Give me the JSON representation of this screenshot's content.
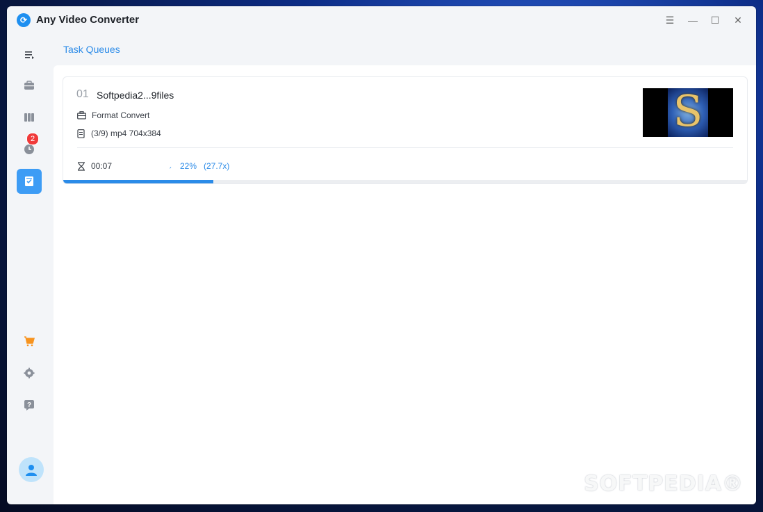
{
  "app": {
    "title": "Any Video Converter",
    "logo_icon": "app-logo-icon"
  },
  "window_controls": [
    "menu-icon",
    "minimize-icon",
    "maximize-icon",
    "close-icon"
  ],
  "sidebar": {
    "items": [
      {
        "name": "menu-toggle",
        "icon": "list-icon"
      },
      {
        "name": "toolbox",
        "icon": "briefcase-icon"
      },
      {
        "name": "library",
        "icon": "columns-icon"
      },
      {
        "name": "history",
        "icon": "clock-icon",
        "badge": "2"
      },
      {
        "name": "task-queues",
        "icon": "checklist-icon",
        "active": true
      },
      {
        "name": "store",
        "icon": "cart-icon"
      },
      {
        "name": "settings",
        "icon": "gear-icon"
      },
      {
        "name": "help",
        "icon": "question-icon"
      }
    ]
  },
  "page": {
    "title": "Task Queues"
  },
  "task": {
    "index": "01",
    "name": "Softpedia2...9files",
    "type": "Format Convert",
    "details": "(3/9) mp4 704x384",
    "elapsed": "00:07",
    "spinner": "ˏ",
    "percent": "22%",
    "speed": "(27.7x)",
    "progress": 0.22,
    "thumbnail_letter": "S"
  },
  "watermark": "SOFTPEDIA®",
  "colors": {
    "accent": "#2b8be8",
    "badge": "#f03a3a",
    "store": "#f7931e"
  }
}
